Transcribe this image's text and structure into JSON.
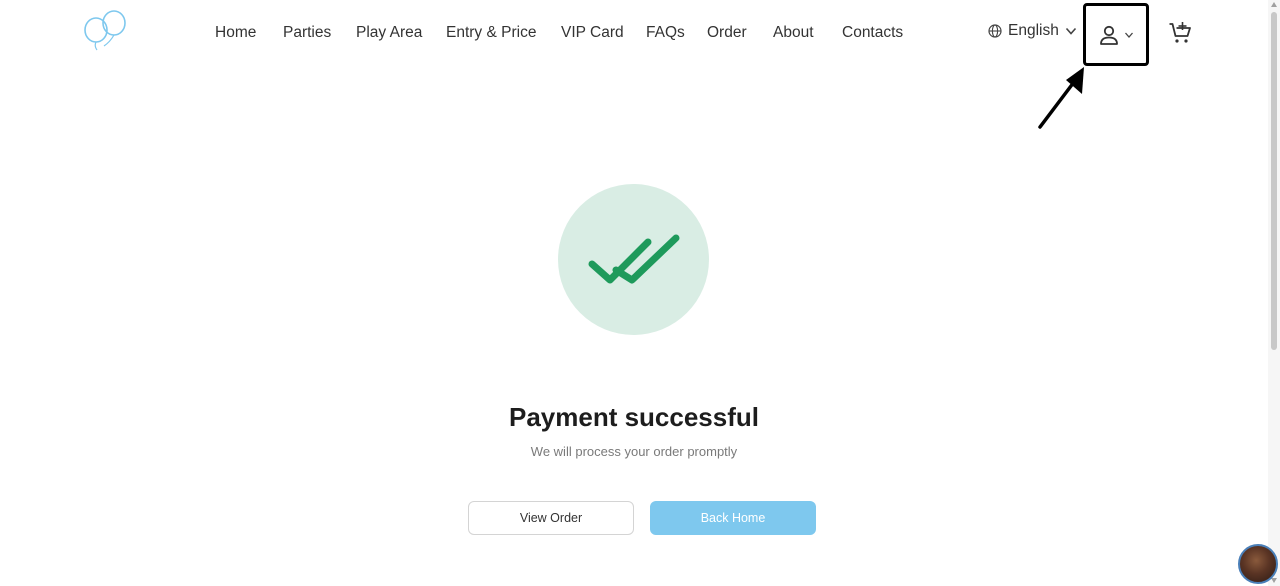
{
  "nav": {
    "items": [
      {
        "label": "Home"
      },
      {
        "label": "Parties"
      },
      {
        "label": "Play Area"
      },
      {
        "label": "Entry & Price"
      },
      {
        "label": "VIP Card"
      },
      {
        "label": "FAQs"
      },
      {
        "label": "Order"
      },
      {
        "label": "About"
      },
      {
        "label": "Contacts"
      }
    ],
    "language": "English",
    "icons": {
      "logo": "balloons-logo",
      "language": "globe-icon",
      "user": "user-icon",
      "cart": "cart-plus-icon"
    }
  },
  "main": {
    "title": "Payment successful",
    "subtitle": "We will process your order promptly",
    "buttons": {
      "view_order": "View Order",
      "back_home": "Back Home"
    },
    "icon": "double-check-icon"
  },
  "colors": {
    "success_circle": "#d9ede4",
    "check": "#1e9a5b",
    "primary_button": "#7ec8ee",
    "logo": "#7ec8ee"
  }
}
